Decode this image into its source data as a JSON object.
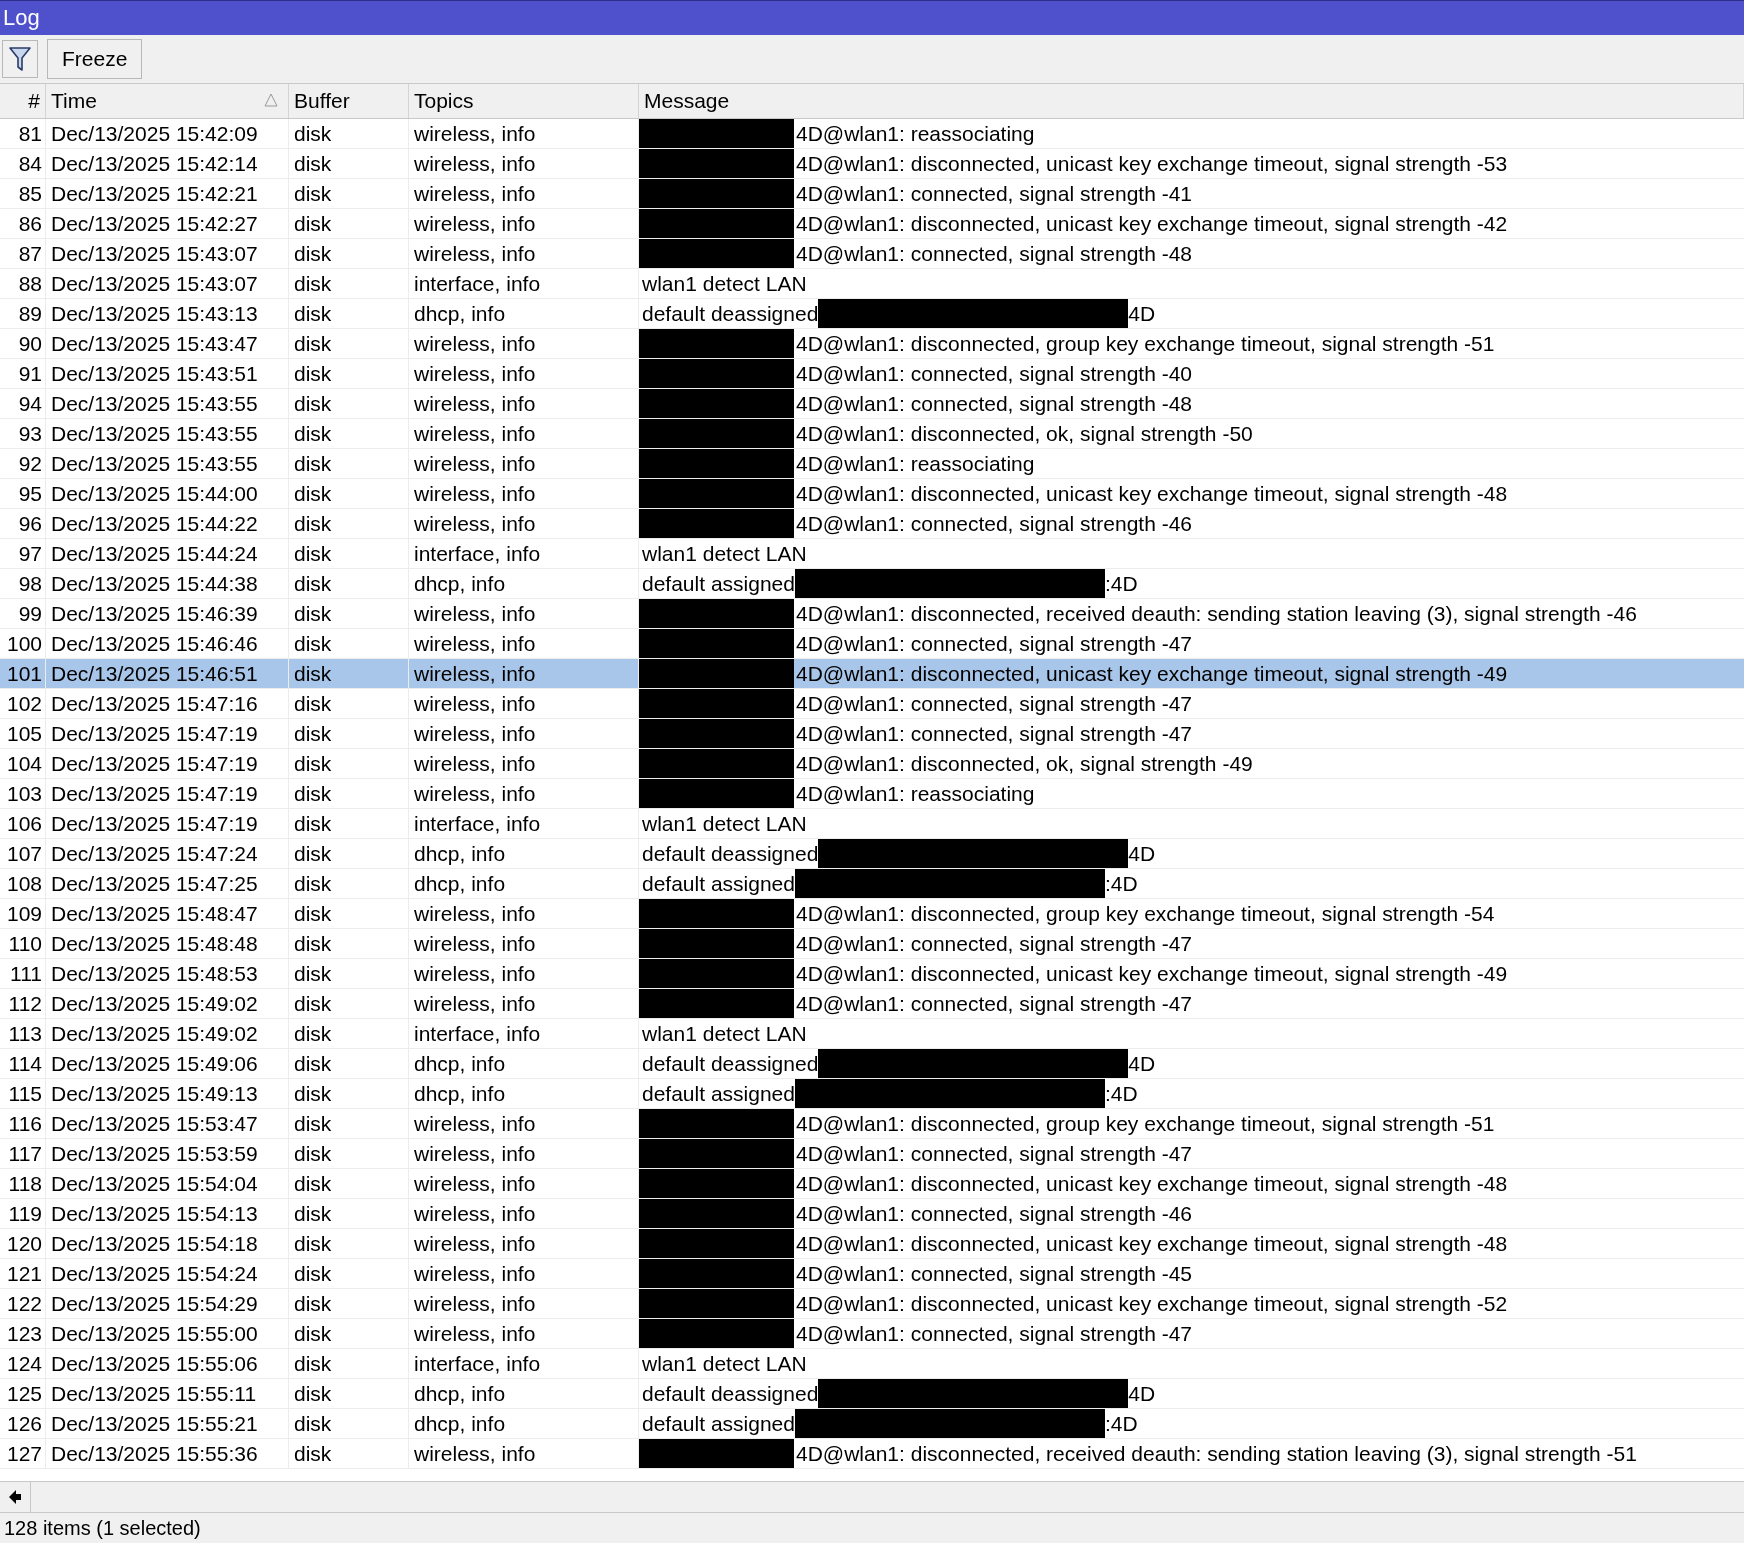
{
  "window": {
    "title": "Log"
  },
  "toolbar": {
    "buttons": [
      {
        "kind": "filter"
      },
      {
        "kind": "text",
        "label": "Freeze"
      }
    ]
  },
  "table": {
    "columns": [
      {
        "label": "#"
      },
      {
        "label": "Time",
        "sorted": true
      },
      {
        "label": "Buffer"
      },
      {
        "label": "Topics"
      },
      {
        "label": "Message"
      }
    ],
    "rows": [
      {
        "num": "81",
        "time": "Dec/13/2025 15:42:09",
        "buffer": "disk",
        "topics": "wireless, info",
        "message": {
          "kind": "redacted_prefix",
          "text": "4D@wlan1: reassociating"
        },
        "selected": false
      },
      {
        "num": "84",
        "time": "Dec/13/2025 15:42:14",
        "buffer": "disk",
        "topics": "wireless, info",
        "message": {
          "kind": "redacted_prefix",
          "text": "4D@wlan1: disconnected, unicast key exchange timeout, signal strength -53"
        },
        "selected": false
      },
      {
        "num": "85",
        "time": "Dec/13/2025 15:42:21",
        "buffer": "disk",
        "topics": "wireless, info",
        "message": {
          "kind": "redacted_prefix",
          "text": "4D@wlan1: connected, signal strength -41"
        },
        "selected": false
      },
      {
        "num": "86",
        "time": "Dec/13/2025 15:42:27",
        "buffer": "disk",
        "topics": "wireless, info",
        "message": {
          "kind": "redacted_prefix",
          "text": "4D@wlan1: disconnected, unicast key exchange timeout, signal strength -42"
        },
        "selected": false
      },
      {
        "num": "87",
        "time": "Dec/13/2025 15:43:07",
        "buffer": "disk",
        "topics": "wireless, info",
        "message": {
          "kind": "redacted_prefix",
          "text": "4D@wlan1: connected, signal strength -48"
        },
        "selected": false
      },
      {
        "num": "88",
        "time": "Dec/13/2025 15:43:07",
        "buffer": "disk",
        "topics": "interface, info",
        "message": {
          "kind": "plain",
          "text": "wlan1 detect LAN"
        },
        "selected": false
      },
      {
        "num": "89",
        "time": "Dec/13/2025 15:43:13",
        "buffer": "disk",
        "topics": "dhcp, info",
        "message": {
          "kind": "redacted_middle",
          "text": "default deassigned",
          "suffix": "4D"
        },
        "selected": false
      },
      {
        "num": "90",
        "time": "Dec/13/2025 15:43:47",
        "buffer": "disk",
        "topics": "wireless, info",
        "message": {
          "kind": "redacted_prefix",
          "text": "4D@wlan1: disconnected, group key exchange timeout, signal strength -51"
        },
        "selected": false
      },
      {
        "num": "91",
        "time": "Dec/13/2025 15:43:51",
        "buffer": "disk",
        "topics": "wireless, info",
        "message": {
          "kind": "redacted_prefix",
          "text": "4D@wlan1: connected, signal strength -40"
        },
        "selected": false
      },
      {
        "num": "94",
        "time": "Dec/13/2025 15:43:55",
        "buffer": "disk",
        "topics": "wireless, info",
        "message": {
          "kind": "redacted_prefix",
          "text": "4D@wlan1: connected, signal strength -48"
        },
        "selected": false
      },
      {
        "num": "93",
        "time": "Dec/13/2025 15:43:55",
        "buffer": "disk",
        "topics": "wireless, info",
        "message": {
          "kind": "redacted_prefix",
          "text": "4D@wlan1: disconnected, ok, signal strength -50"
        },
        "selected": false
      },
      {
        "num": "92",
        "time": "Dec/13/2025 15:43:55",
        "buffer": "disk",
        "topics": "wireless, info",
        "message": {
          "kind": "redacted_prefix",
          "text": "4D@wlan1: reassociating"
        },
        "selected": false
      },
      {
        "num": "95",
        "time": "Dec/13/2025 15:44:00",
        "buffer": "disk",
        "topics": "wireless, info",
        "message": {
          "kind": "redacted_prefix",
          "text": "4D@wlan1: disconnected, unicast key exchange timeout, signal strength -48"
        },
        "selected": false
      },
      {
        "num": "96",
        "time": "Dec/13/2025 15:44:22",
        "buffer": "disk",
        "topics": "wireless, info",
        "message": {
          "kind": "redacted_prefix",
          "text": "4D@wlan1: connected, signal strength -46"
        },
        "selected": false
      },
      {
        "num": "97",
        "time": "Dec/13/2025 15:44:24",
        "buffer": "disk",
        "topics": "interface, info",
        "message": {
          "kind": "plain",
          "text": "wlan1 detect LAN"
        },
        "selected": false
      },
      {
        "num": "98",
        "time": "Dec/13/2025 15:44:38",
        "buffer": "disk",
        "topics": "dhcp, info",
        "message": {
          "kind": "redacted_middle",
          "text": "default assigned",
          "suffix": ":4D"
        },
        "selected": false
      },
      {
        "num": "99",
        "time": "Dec/13/2025 15:46:39",
        "buffer": "disk",
        "topics": "wireless, info",
        "message": {
          "kind": "redacted_prefix",
          "text": "4D@wlan1: disconnected, received deauth: sending station leaving (3), signal strength -46"
        },
        "selected": false
      },
      {
        "num": "100",
        "time": "Dec/13/2025 15:46:46",
        "buffer": "disk",
        "topics": "wireless, info",
        "message": {
          "kind": "redacted_prefix",
          "text": "4D@wlan1: connected, signal strength -47"
        },
        "selected": false
      },
      {
        "num": "101",
        "time": "Dec/13/2025 15:46:51",
        "buffer": "disk",
        "topics": "wireless, info",
        "message": {
          "kind": "redacted_prefix",
          "text": "4D@wlan1: disconnected, unicast key exchange timeout, signal strength -49"
        },
        "selected": true
      },
      {
        "num": "102",
        "time": "Dec/13/2025 15:47:16",
        "buffer": "disk",
        "topics": "wireless, info",
        "message": {
          "kind": "redacted_prefix",
          "text": "4D@wlan1: connected, signal strength -47"
        },
        "selected": false
      },
      {
        "num": "105",
        "time": "Dec/13/2025 15:47:19",
        "buffer": "disk",
        "topics": "wireless, info",
        "message": {
          "kind": "redacted_prefix",
          "text": "4D@wlan1: connected, signal strength -47"
        },
        "selected": false
      },
      {
        "num": "104",
        "time": "Dec/13/2025 15:47:19",
        "buffer": "disk",
        "topics": "wireless, info",
        "message": {
          "kind": "redacted_prefix",
          "text": "4D@wlan1: disconnected, ok, signal strength -49"
        },
        "selected": false
      },
      {
        "num": "103",
        "time": "Dec/13/2025 15:47:19",
        "buffer": "disk",
        "topics": "wireless, info",
        "message": {
          "kind": "redacted_prefix",
          "text": "4D@wlan1: reassociating"
        },
        "selected": false
      },
      {
        "num": "106",
        "time": "Dec/13/2025 15:47:19",
        "buffer": "disk",
        "topics": "interface, info",
        "message": {
          "kind": "plain",
          "text": "wlan1 detect LAN"
        },
        "selected": false
      },
      {
        "num": "107",
        "time": "Dec/13/2025 15:47:24",
        "buffer": "disk",
        "topics": "dhcp, info",
        "message": {
          "kind": "redacted_middle",
          "text": "default deassigned",
          "suffix": "4D"
        },
        "selected": false
      },
      {
        "num": "108",
        "time": "Dec/13/2025 15:47:25",
        "buffer": "disk",
        "topics": "dhcp, info",
        "message": {
          "kind": "redacted_middle",
          "text": "default assigned",
          "suffix": ":4D"
        },
        "selected": false
      },
      {
        "num": "109",
        "time": "Dec/13/2025 15:48:47",
        "buffer": "disk",
        "topics": "wireless, info",
        "message": {
          "kind": "redacted_prefix",
          "text": "4D@wlan1: disconnected, group key exchange timeout, signal strength -54"
        },
        "selected": false
      },
      {
        "num": "110",
        "time": "Dec/13/2025 15:48:48",
        "buffer": "disk",
        "topics": "wireless, info",
        "message": {
          "kind": "redacted_prefix",
          "text": "4D@wlan1: connected, signal strength -47"
        },
        "selected": false
      },
      {
        "num": "111",
        "time": "Dec/13/2025 15:48:53",
        "buffer": "disk",
        "topics": "wireless, info",
        "message": {
          "kind": "redacted_prefix",
          "text": "4D@wlan1: disconnected, unicast key exchange timeout, signal strength -49"
        },
        "selected": false
      },
      {
        "num": "112",
        "time": "Dec/13/2025 15:49:02",
        "buffer": "disk",
        "topics": "wireless, info",
        "message": {
          "kind": "redacted_prefix",
          "text": "4D@wlan1: connected, signal strength -47"
        },
        "selected": false
      },
      {
        "num": "113",
        "time": "Dec/13/2025 15:49:02",
        "buffer": "disk",
        "topics": "interface, info",
        "message": {
          "kind": "plain",
          "text": "wlan1 detect LAN"
        },
        "selected": false
      },
      {
        "num": "114",
        "time": "Dec/13/2025 15:49:06",
        "buffer": "disk",
        "topics": "dhcp, info",
        "message": {
          "kind": "redacted_middle",
          "text": "default deassigned",
          "suffix": "4D"
        },
        "selected": false
      },
      {
        "num": "115",
        "time": "Dec/13/2025 15:49:13",
        "buffer": "disk",
        "topics": "dhcp, info",
        "message": {
          "kind": "redacted_middle",
          "text": "default assigned",
          "suffix": ":4D"
        },
        "selected": false
      },
      {
        "num": "116",
        "time": "Dec/13/2025 15:53:47",
        "buffer": "disk",
        "topics": "wireless, info",
        "message": {
          "kind": "redacted_prefix",
          "text": "4D@wlan1: disconnected, group key exchange timeout, signal strength -51"
        },
        "selected": false
      },
      {
        "num": "117",
        "time": "Dec/13/2025 15:53:59",
        "buffer": "disk",
        "topics": "wireless, info",
        "message": {
          "kind": "redacted_prefix",
          "text": "4D@wlan1: connected, signal strength -47"
        },
        "selected": false
      },
      {
        "num": "118",
        "time": "Dec/13/2025 15:54:04",
        "buffer": "disk",
        "topics": "wireless, info",
        "message": {
          "kind": "redacted_prefix",
          "text": "4D@wlan1: disconnected, unicast key exchange timeout, signal strength -48"
        },
        "selected": false
      },
      {
        "num": "119",
        "time": "Dec/13/2025 15:54:13",
        "buffer": "disk",
        "topics": "wireless, info",
        "message": {
          "kind": "redacted_prefix",
          "text": "4D@wlan1: connected, signal strength -46"
        },
        "selected": false
      },
      {
        "num": "120",
        "time": "Dec/13/2025 15:54:18",
        "buffer": "disk",
        "topics": "wireless, info",
        "message": {
          "kind": "redacted_prefix",
          "text": "4D@wlan1: disconnected, unicast key exchange timeout, signal strength -48"
        },
        "selected": false
      },
      {
        "num": "121",
        "time": "Dec/13/2025 15:54:24",
        "buffer": "disk",
        "topics": "wireless, info",
        "message": {
          "kind": "redacted_prefix",
          "text": "4D@wlan1: connected, signal strength -45"
        },
        "selected": false
      },
      {
        "num": "122",
        "time": "Dec/13/2025 15:54:29",
        "buffer": "disk",
        "topics": "wireless, info",
        "message": {
          "kind": "redacted_prefix",
          "text": "4D@wlan1: disconnected, unicast key exchange timeout, signal strength -52"
        },
        "selected": false
      },
      {
        "num": "123",
        "time": "Dec/13/2025 15:55:00",
        "buffer": "disk",
        "topics": "wireless, info",
        "message": {
          "kind": "redacted_prefix",
          "text": "4D@wlan1: connected, signal strength -47"
        },
        "selected": false
      },
      {
        "num": "124",
        "time": "Dec/13/2025 15:55:06",
        "buffer": "disk",
        "topics": "interface, info",
        "message": {
          "kind": "plain",
          "text": "wlan1 detect LAN"
        },
        "selected": false
      },
      {
        "num": "125",
        "time": "Dec/13/2025 15:55:11",
        "buffer": "disk",
        "topics": "dhcp, info",
        "message": {
          "kind": "redacted_middle",
          "text": "default deassigned",
          "suffix": "4D"
        },
        "selected": false
      },
      {
        "num": "126",
        "time": "Dec/13/2025 15:55:21",
        "buffer": "disk",
        "topics": "dhcp, info",
        "message": {
          "kind": "redacted_middle",
          "text": "default assigned",
          "suffix": ":4D"
        },
        "selected": false
      },
      {
        "num": "127",
        "time": "Dec/13/2025 15:55:36",
        "buffer": "disk",
        "topics": "wireless, info",
        "message": {
          "kind": "redacted_prefix",
          "text": "4D@wlan1: disconnected, received deauth: sending station leaving (3), signal strength -51"
        },
        "selected": false
      }
    ]
  },
  "status_bar": {
    "text": "128 items (1 selected)"
  }
}
